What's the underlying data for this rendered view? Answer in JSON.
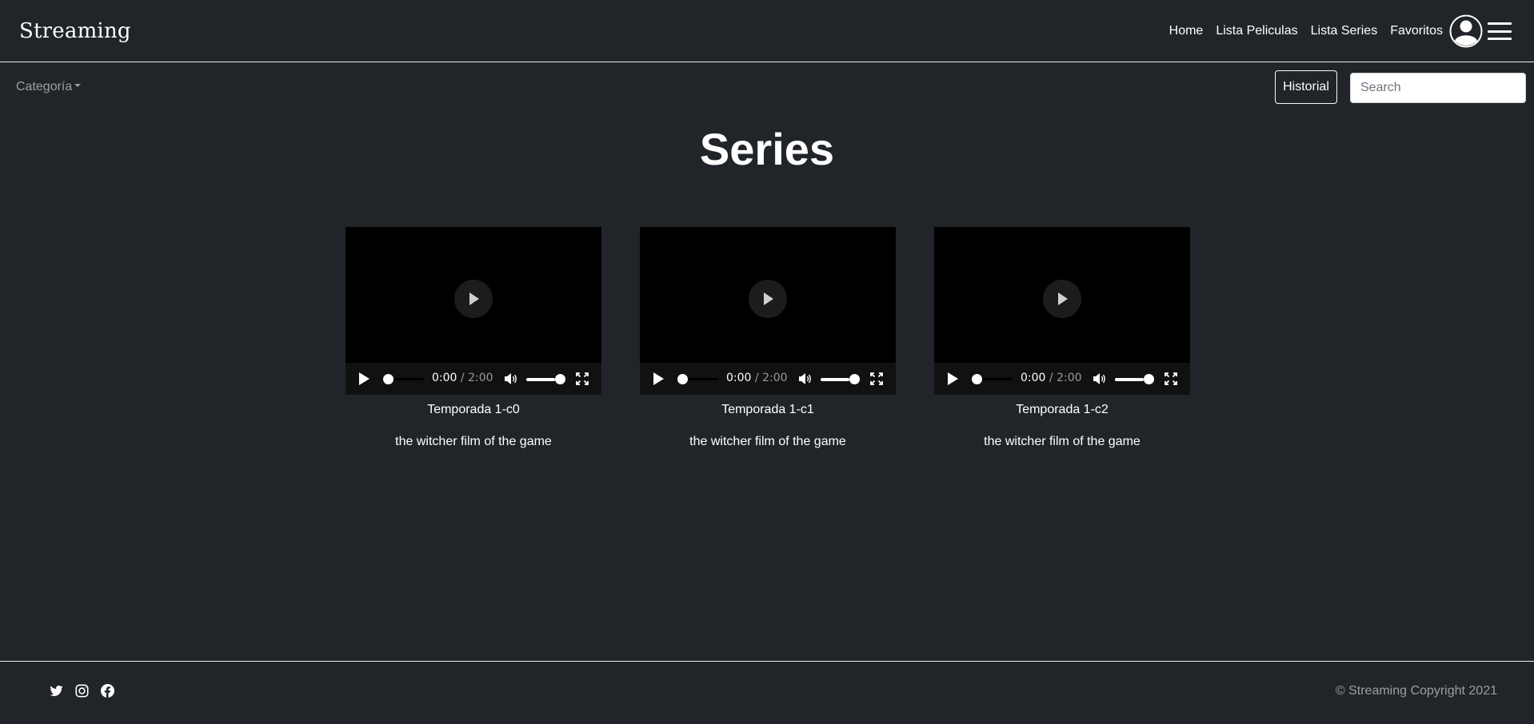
{
  "navbar": {
    "brand": "Streaming",
    "links": [
      "Home",
      "Lista Peliculas",
      "Lista Series",
      "Favoritos"
    ],
    "user_icon": "user-circle-icon",
    "menu_icon": "hamburger-menu-icon"
  },
  "subbar": {
    "category_label": "Categoría",
    "history_button": "Historial",
    "search_placeholder": "Search"
  },
  "main": {
    "title": "Series",
    "videos": [
      {
        "title": "Temporada 1-c0",
        "description": "the witcher film of the game",
        "current_time": "0:00",
        "duration": "2:00",
        "progress": 0,
        "volume": 1
      },
      {
        "title": "Temporada 1-c1",
        "description": "the witcher film of the game",
        "current_time": "0:00",
        "duration": "2:00",
        "progress": 0,
        "volume": 1
      },
      {
        "title": "Temporada 1-c2",
        "description": "the witcher film of the game",
        "current_time": "0:00",
        "duration": "2:00",
        "progress": 0,
        "volume": 1
      }
    ]
  },
  "footer": {
    "social_icons": [
      "twitter-icon",
      "instagram-icon",
      "facebook-icon"
    ],
    "copyright": "© Streaming Copyright 2021"
  },
  "colors": {
    "background": "#212529",
    "text": "#ffffff",
    "muted": "#8c8f92",
    "video_bg": "#000000"
  }
}
